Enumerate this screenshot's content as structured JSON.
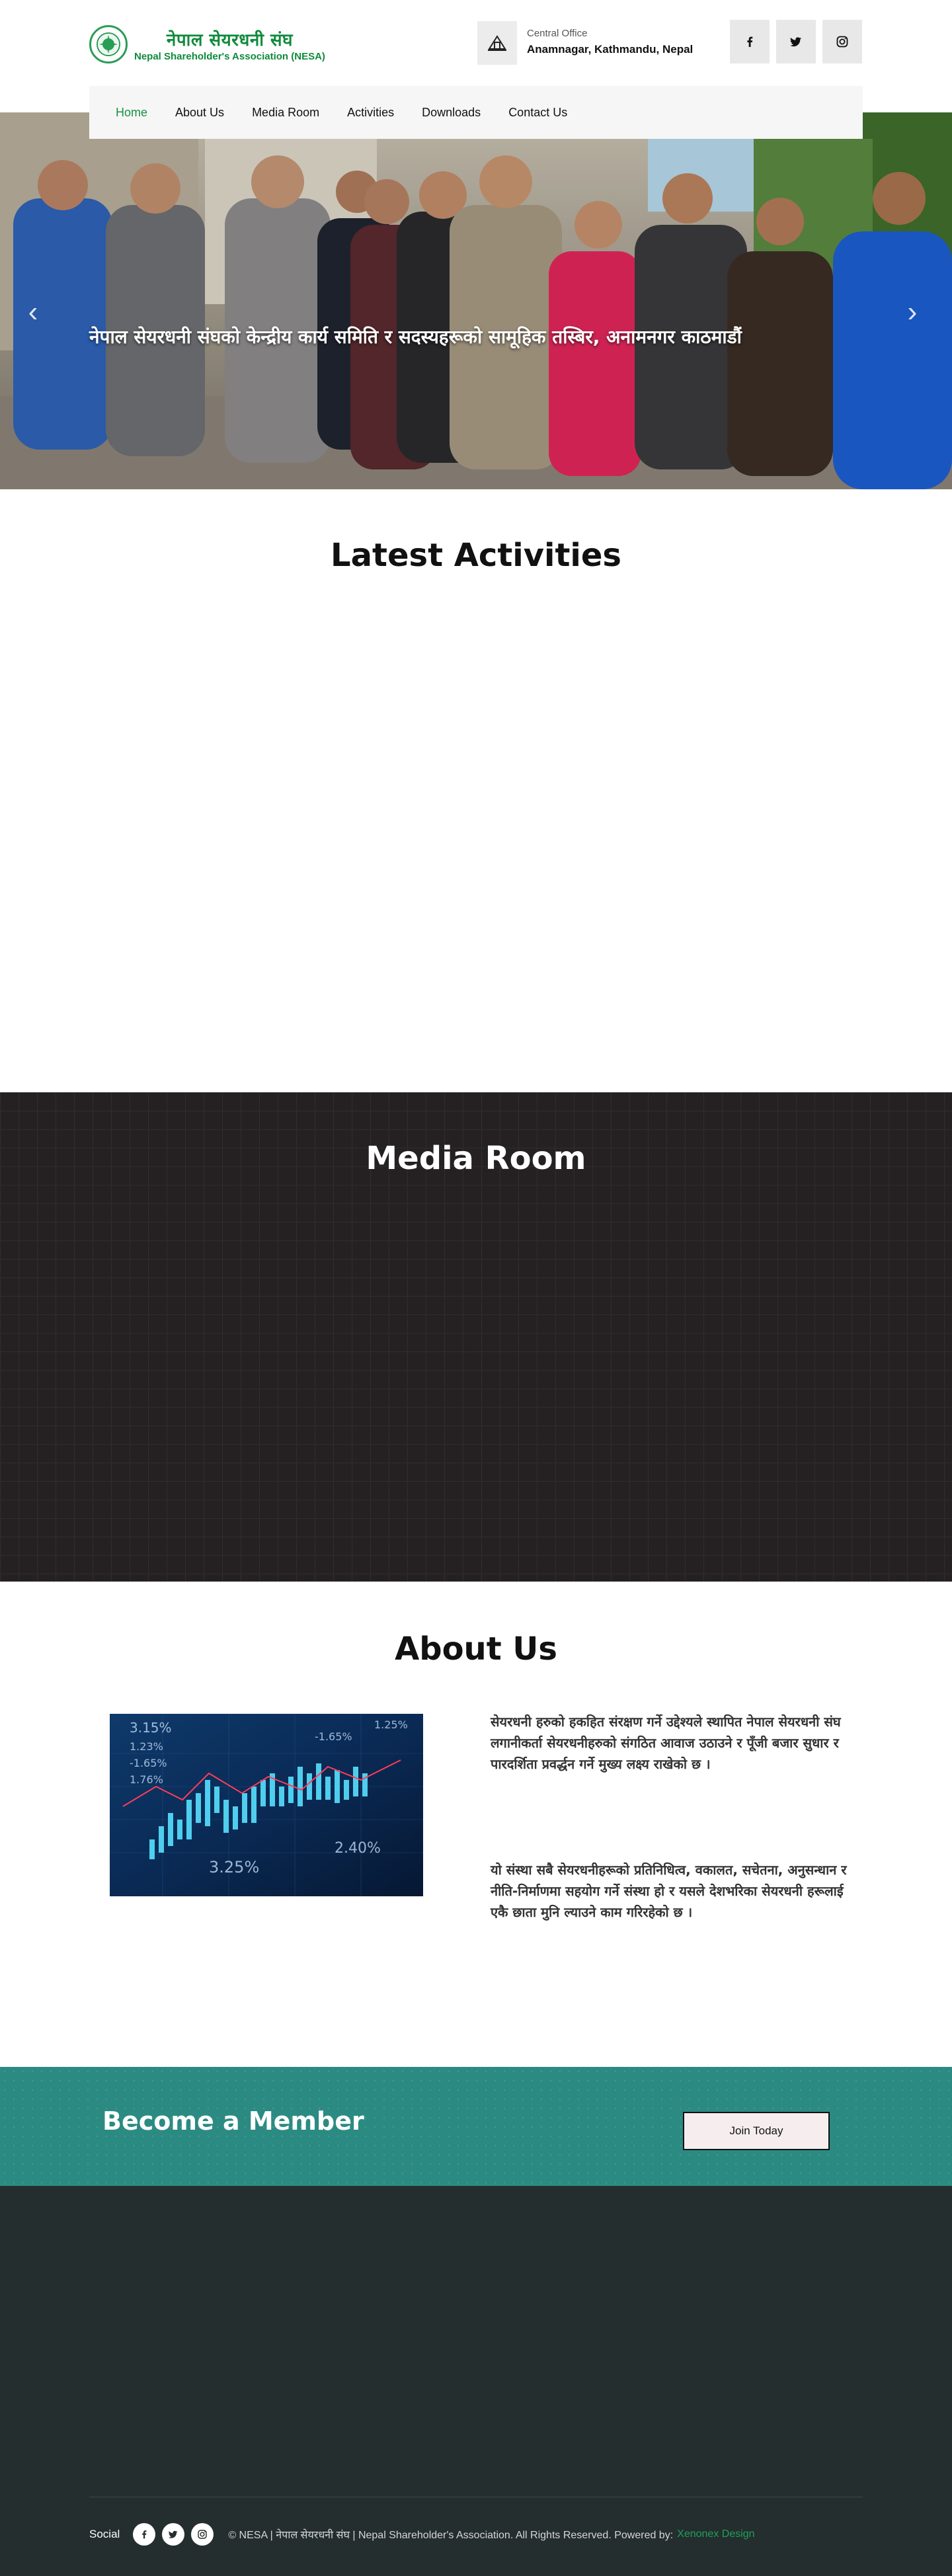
{
  "header": {
    "logo_nepali": "नेपाल सेयरधनी संघ",
    "logo_english": "Nepal Shareholder's Association (NESA)",
    "office_label": "Central Office",
    "office_address": "Anamnagar, Kathmandu, Nepal",
    "social": [
      "facebook-icon",
      "twitter-icon",
      "instagram-icon"
    ]
  },
  "nav": {
    "items": [
      {
        "label": "Home",
        "active": true
      },
      {
        "label": "About Us"
      },
      {
        "label": "Media Room"
      },
      {
        "label": "Activities"
      },
      {
        "label": "Downloads"
      },
      {
        "label": "Contact Us"
      }
    ]
  },
  "hero": {
    "caption": "नेपाल सेयरधनी संघको केन्द्रीय कार्य समिति र सदस्यहरूको सामूहिक तस्बिर, अनामनगर काठमाडौं"
  },
  "sections": {
    "latest_activities": "Latest Activities",
    "media_room": "Media Room",
    "about_us": "About Us"
  },
  "about": {
    "paragraph_1": "सेयरधनी हरुको हकहित संरक्षण गर्ने उद्देश्यले स्थापित नेपाल सेयरधनी संघ लगानीकर्ता सेयरधनीहरुको संगठित आवाज उठाउने र पूँजी बजार सुधार र पारदर्शिता प्रवर्द्धन गर्ने मुख्य लक्ष्य राखेको छ ।",
    "paragraph_2": "यो संस्था सबै सेयरधनीहरूको प्रतिनिधित्व, वकालत, सचेतना, अनुसन्धान र नीति-निर्माणमा सहयोग गर्ने संस्था हो र यसले देशभरिका सेयरधनी हरूलाई एकै छाता मुनि ल्याउने काम गरिरहेको छ ।"
  },
  "member": {
    "title": "Become a Member",
    "button": "Join Today"
  },
  "footer": {
    "social_label": "Social",
    "copyright": "© NESA | नेपाल सेयरधनी संघ | Nepal Shareholder's Association. All Rights Reserved. Powered by:",
    "powered_by": "Xenonex Design"
  }
}
